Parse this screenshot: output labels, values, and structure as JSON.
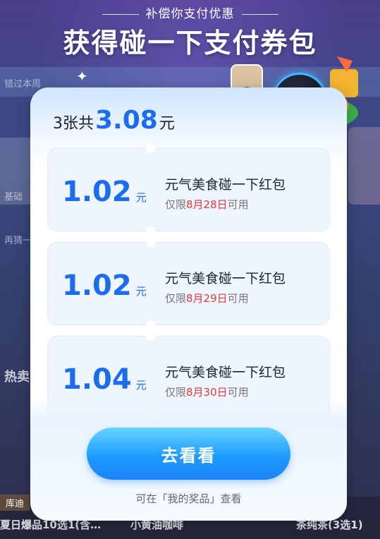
{
  "header": {
    "subtitle": "补偿你支付优惠",
    "title": "获得碰一下支付券包"
  },
  "background": {
    "left_label_1": "错过本周",
    "left_label_2": "基础",
    "left_label_3": "再猜一",
    "hot_label": "热卖",
    "kudi": "库迪",
    "bottom_items": [
      "夏日爆品10选1(含…",
      "小黄油咖啡",
      "茶纯茶(3选1)"
    ]
  },
  "card": {
    "summary_prefix": "3张共",
    "summary_amount": "3.08",
    "summary_unit": "元",
    "coupons": [
      {
        "value": "1.02",
        "unit": "元",
        "name": "元气美食碰一下红包",
        "valid_prefix": "仅限",
        "valid_date": "8月28日",
        "valid_suffix": "可用"
      },
      {
        "value": "1.02",
        "unit": "元",
        "name": "元气美食碰一下红包",
        "valid_prefix": "仅限",
        "valid_date": "8月29日",
        "valid_suffix": "可用"
      },
      {
        "value": "1.04",
        "unit": "元",
        "name": "元气美食碰一下红包",
        "valid_prefix": "仅限",
        "valid_date": "8月30日",
        "valid_suffix": "可用"
      }
    ],
    "button_label": "去看看",
    "hint": "可在「我的奖品」查看"
  },
  "icons": {
    "alipay": "alipay-nfc-icon",
    "pay_char": "支"
  },
  "colors": {
    "accent": "#1a6cf0",
    "date_red": "#e53935",
    "button_top": "#66d4ff",
    "button_bottom": "#1b84f5"
  }
}
